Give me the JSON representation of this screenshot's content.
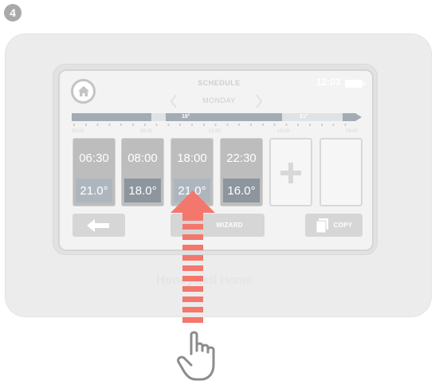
{
  "step": {
    "number": "4"
  },
  "screen": {
    "title": "SCHEDULE",
    "clock": "12:03",
    "day": "MONDAY",
    "timeline": {
      "labels": [
        "18°",
        "21°"
      ],
      "ticks": [
        "00:00",
        "06:00",
        "12:00",
        "18:00",
        "24:00"
      ]
    },
    "slots": [
      {
        "time": "06:30",
        "temp": "21.0°"
      },
      {
        "time": "08:00",
        "temp": "18.0°"
      },
      {
        "time": "18:00",
        "temp": "21.0°"
      },
      {
        "time": "22:30",
        "temp": "16.0°"
      }
    ],
    "buttons": {
      "wizard": "WIZARD",
      "copy": "COPY"
    }
  },
  "brand": {
    "bold": "Honeywell",
    "regular": "Home"
  },
  "colors": {
    "swipe_arrow": "#f3776d",
    "slot_card": "#bdbdbd",
    "timeline_bar": "#a3acb4"
  },
  "icons": [
    "home-icon",
    "chevron-left-icon",
    "chevron-right-icon",
    "plus-icon",
    "back-arrow-icon",
    "copy-icon",
    "swipe-up-arrow-icon",
    "hand-pointer-icon"
  ]
}
